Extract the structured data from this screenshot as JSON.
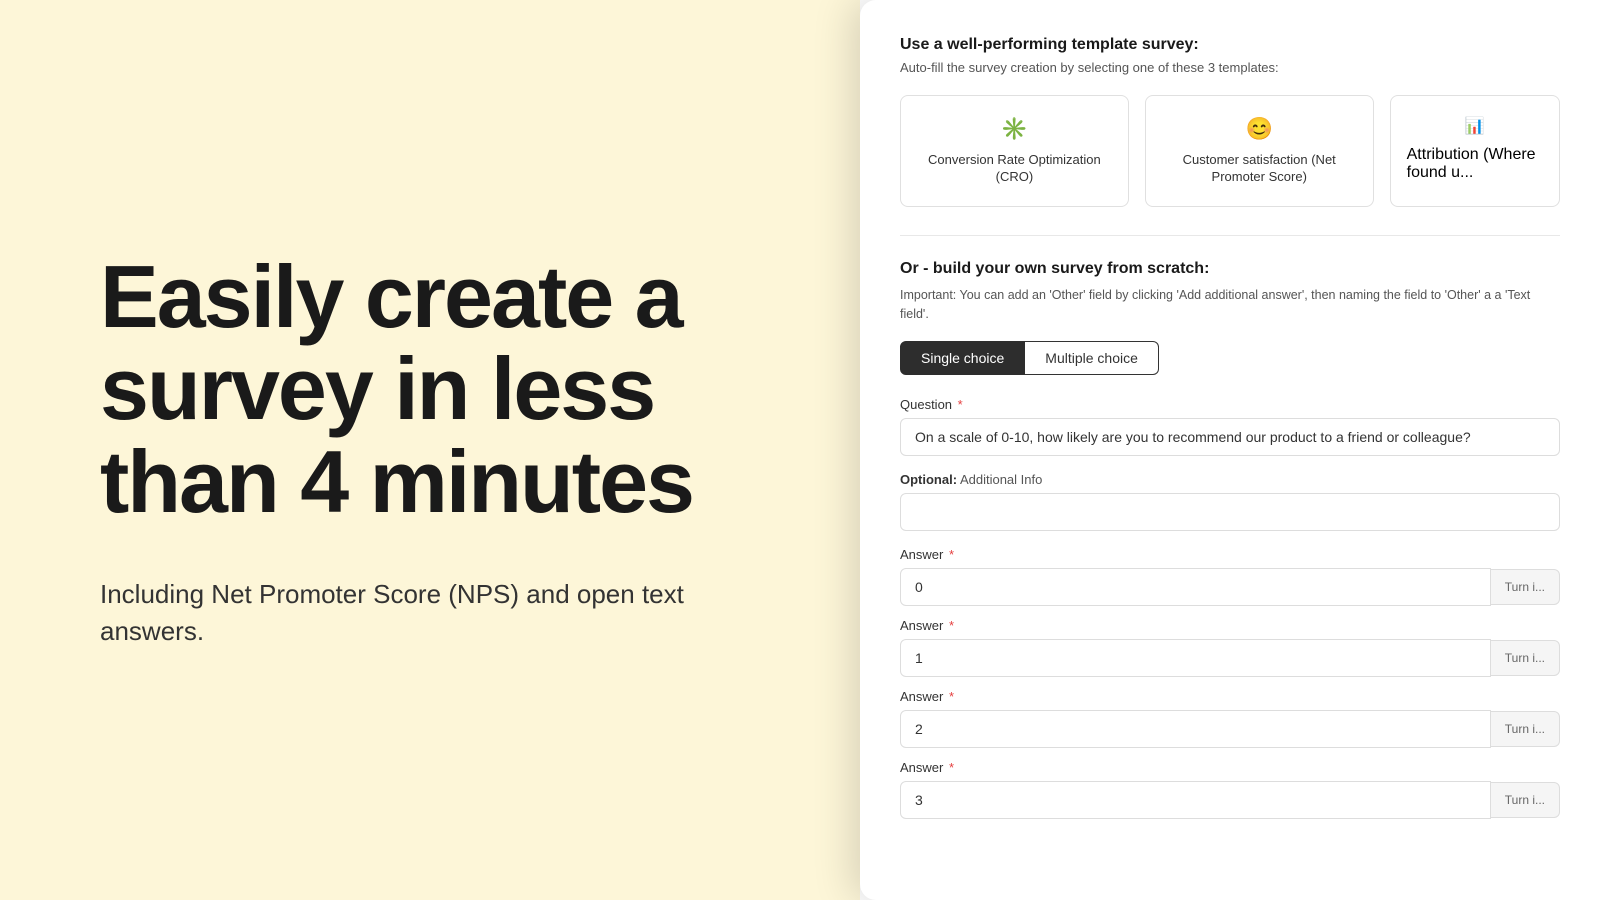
{
  "left": {
    "hero_title": "Easily create a survey in less than 4 minutes",
    "hero_subtitle": "Including Net Promoter Score (NPS) and open text answers."
  },
  "right": {
    "template_section": {
      "heading": "Use a well-performing template survey:",
      "subtext": "Auto-fill the survey creation by selecting one of these 3 templates:",
      "templates": [
        {
          "icon": "✳",
          "label": "Conversion Rate Optimization (CRO)"
        },
        {
          "icon": "☺",
          "label": "Customer satisfaction (Net Promoter Score)"
        },
        {
          "icon": "📊",
          "label": "Attribution (Where found u..."
        }
      ]
    },
    "build_section": {
      "heading": "Or - build your own survey from scratch:",
      "note": "Important: You can add an 'Other' field by clicking 'Add additional answer', then naming the field to 'Other' a a 'Text field'.",
      "toggle": {
        "single_choice": "Single choice",
        "multiple_choice": "Multiple choice",
        "active": "single"
      },
      "question_label": "Question",
      "question_placeholder": "On a scale of 0-10, how likely are you to recommend our product to a friend or colleague?",
      "optional_label": "Optional:",
      "optional_subtext": "Additional Info",
      "optional_placeholder": "",
      "answers": [
        {
          "label": "Answer",
          "value": "0",
          "turn_btn": "Turn i..."
        },
        {
          "label": "Answer",
          "value": "1",
          "turn_btn": "Turn i..."
        },
        {
          "label": "Answer",
          "value": "2",
          "turn_btn": "Turn i..."
        },
        {
          "label": "Answer",
          "value": "3",
          "turn_btn": "Turn i..."
        }
      ]
    }
  }
}
